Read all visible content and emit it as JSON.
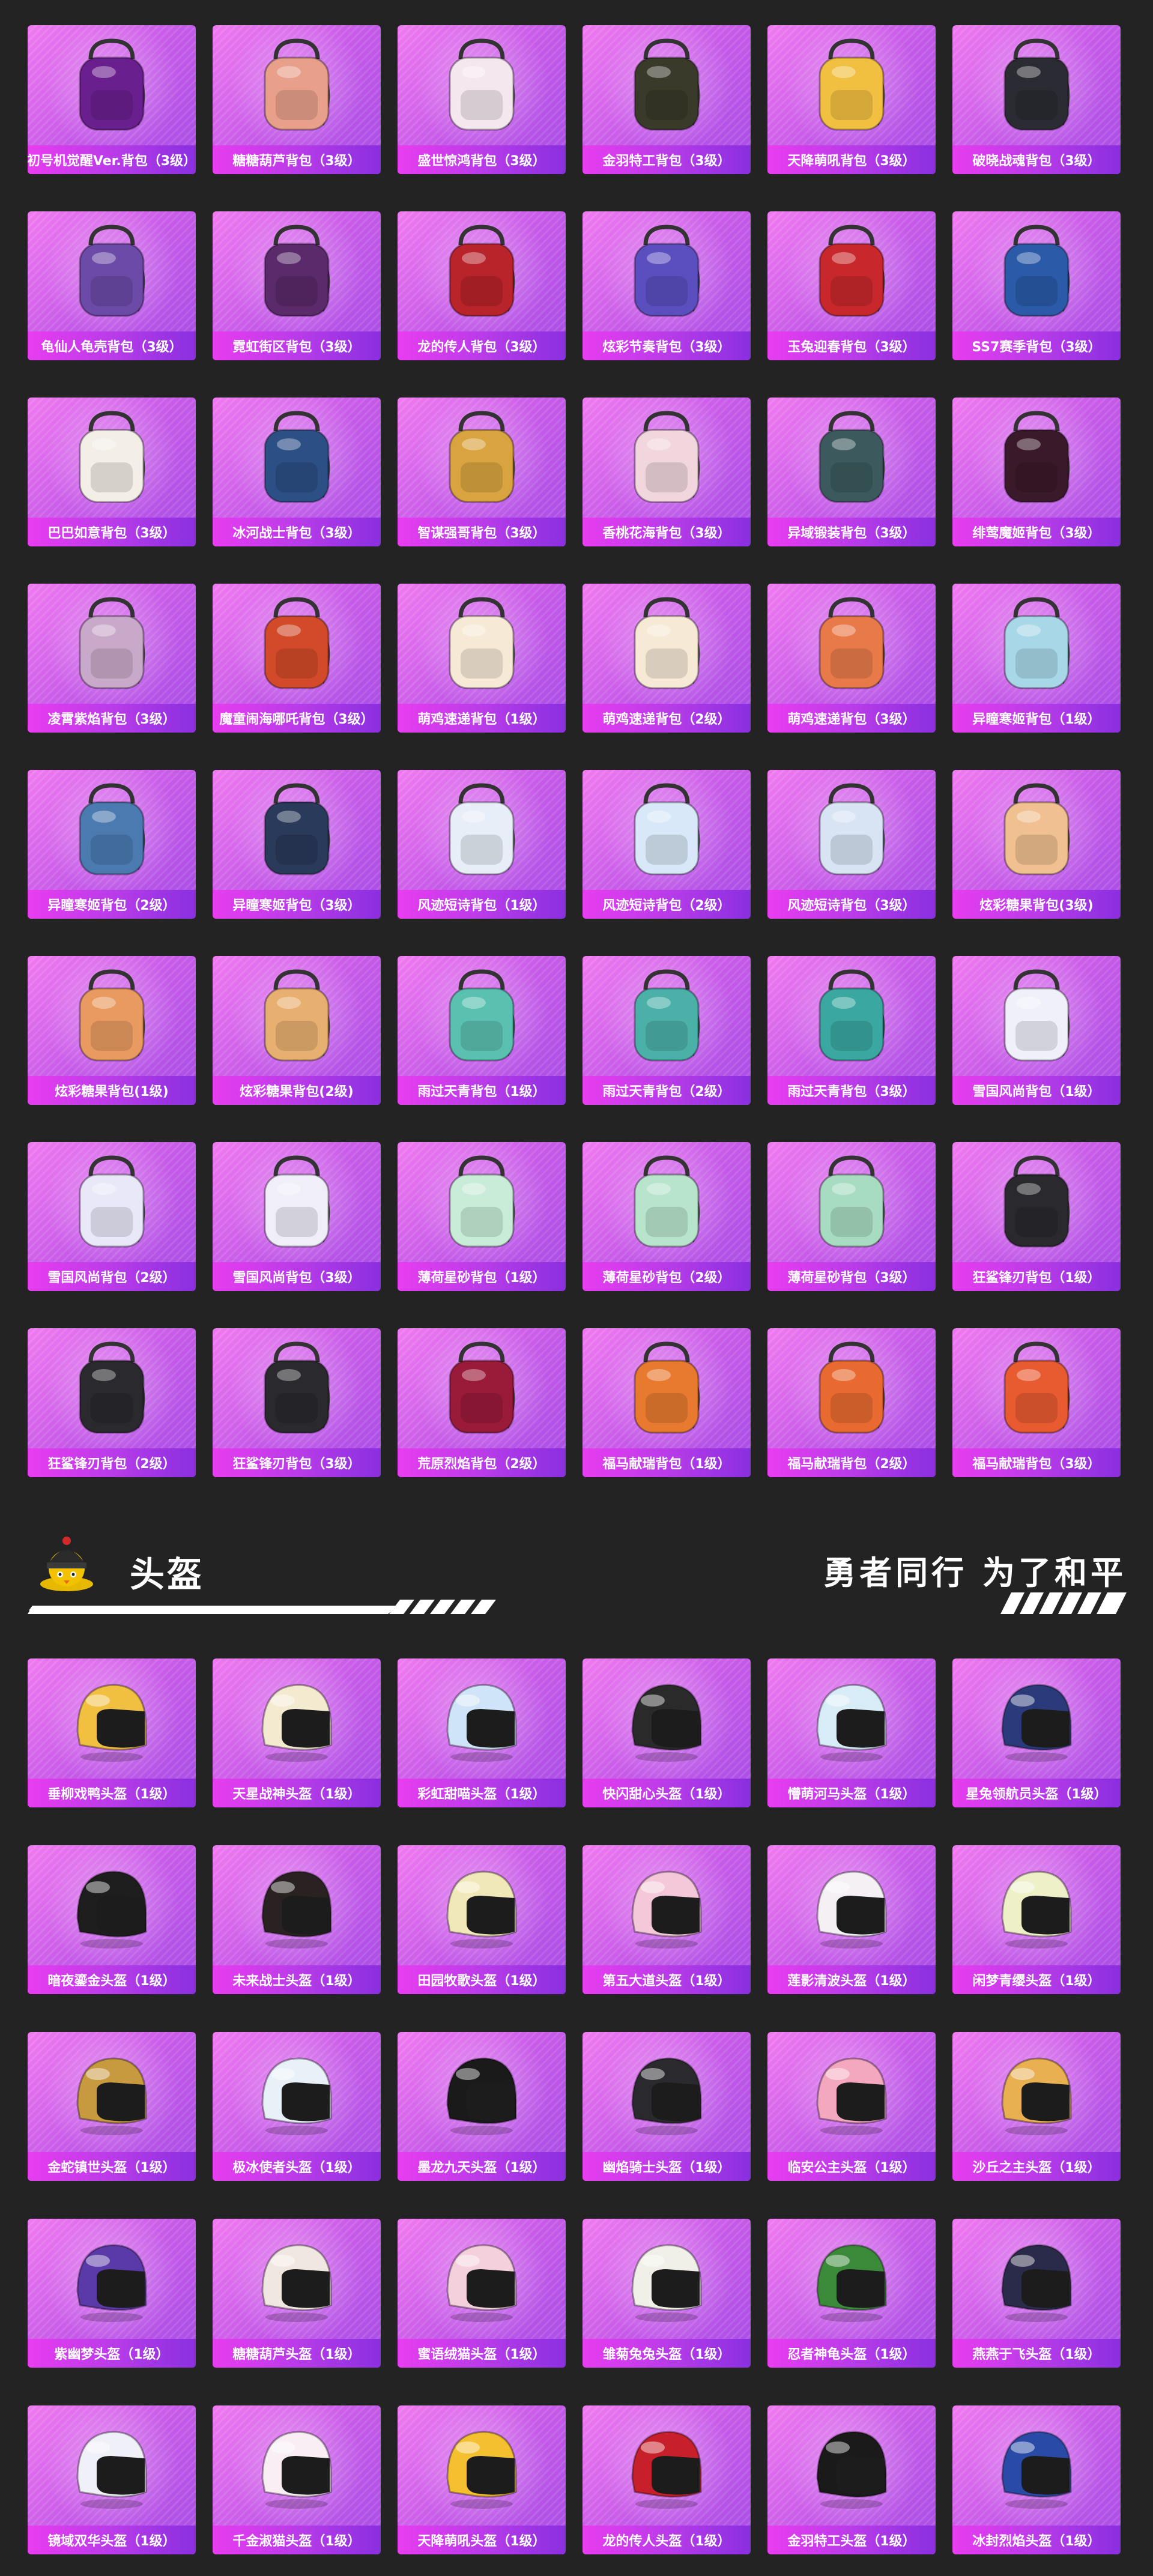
{
  "sections": {
    "helmets_title": "头盔",
    "slogan": "勇者同行 为了和平"
  },
  "backpacks": [
    {
      "name": "初号机觉醒Ver.背包（3级）",
      "color": "#6a1f8f",
      "shape": "backpack"
    },
    {
      "name": "糖糖葫芦背包（3级）",
      "color": "#e8a08a",
      "shape": "backpack"
    },
    {
      "name": "盛世惊鸿背包（3级）",
      "color": "#f4e8ee",
      "shape": "backpack"
    },
    {
      "name": "金羽特工背包（3级）",
      "color": "#3a3a2a",
      "shape": "backpack"
    },
    {
      "name": "天降萌吼背包（3级）",
      "color": "#f1c040",
      "shape": "backpack"
    },
    {
      "name": "破晓战魂背包（3级）",
      "color": "#2b2b33",
      "shape": "backpack"
    },
    {
      "name": "龟仙人龟壳背包（3级）",
      "color": "#6b4aa8",
      "shape": "backpack"
    },
    {
      "name": "霓虹街区背包（3级）",
      "color": "#5a2a6a",
      "shape": "backpack"
    },
    {
      "name": "龙的传人背包（3级）",
      "color": "#b8242a",
      "shape": "backpack"
    },
    {
      "name": "炫彩节奏背包（3级）",
      "color": "#5b4fc0",
      "shape": "backpack"
    },
    {
      "name": "玉兔迎春背包（3级）",
      "color": "#c8282c",
      "shape": "backpack"
    },
    {
      "name": "SS7赛季背包（3级）",
      "color": "#2a5aa8",
      "shape": "backpack"
    },
    {
      "name": "巴巴如意背包（3级）",
      "color": "#f3eee6",
      "shape": "backpack"
    },
    {
      "name": "冰河战士背包（3级）",
      "color": "#2c4f86",
      "shape": "backpack"
    },
    {
      "name": "智谋强哥背包（3级）",
      "color": "#d9a440",
      "shape": "backpack"
    },
    {
      "name": "香桃花海背包（3级）",
      "color": "#f2d6de",
      "shape": "backpack"
    },
    {
      "name": "异域锻装背包（3级）",
      "color": "#3c5a5e",
      "shape": "backpack"
    },
    {
      "name": "绯莺魔姬背包（3级）",
      "color": "#3a1a2a",
      "shape": "backpack"
    },
    {
      "name": "凌霄紫焰背包（3级）",
      "color": "#c9a9c9",
      "shape": "backpack"
    },
    {
      "name": "魔童闹海哪吒背包（3级）",
      "color": "#d24a2a",
      "shape": "backpack"
    },
    {
      "name": "萌鸡速递背包（1级）",
      "color": "#f6ead6",
      "shape": "backpack"
    },
    {
      "name": "萌鸡速递背包（2级）",
      "color": "#f6ead6",
      "shape": "backpack"
    },
    {
      "name": "萌鸡速递背包（3级）",
      "color": "#e87a4a",
      "shape": "backpack"
    },
    {
      "name": "异瞳寒姬背包（1级）",
      "color": "#a8d8e8",
      "shape": "backpack"
    },
    {
      "name": "异瞳寒姬背包（2级）",
      "color": "#4a7ab0",
      "shape": "backpack"
    },
    {
      "name": "异瞳寒姬背包（3级）",
      "color": "#2a3a5a",
      "shape": "backpack"
    },
    {
      "name": "风迹短诗背包（1级）",
      "color": "#e8eef8",
      "shape": "backpack"
    },
    {
      "name": "风迹短诗背包（2级）",
      "color": "#d8e8f8",
      "shape": "backpack"
    },
    {
      "name": "风迹短诗背包（3级）",
      "color": "#d8e4f4",
      "shape": "backpack"
    },
    {
      "name": "炫彩糖果背包(3级)",
      "color": "#f0c090",
      "shape": "backpack"
    },
    {
      "name": "炫彩糖果背包(1级)",
      "color": "#e89a60",
      "shape": "backpack"
    },
    {
      "name": "炫彩糖果背包(2级)",
      "color": "#e8b070",
      "shape": "backpack"
    },
    {
      "name": "雨过天青背包（1级）",
      "color": "#5ac0b0",
      "shape": "backpack"
    },
    {
      "name": "雨过天青背包（2级）",
      "color": "#4ab0a8",
      "shape": "backpack"
    },
    {
      "name": "雨过天青背包（3级）",
      "color": "#3aa8a0",
      "shape": "backpack"
    },
    {
      "name": "雪国风尚背包（1级）",
      "color": "#f0f0fa",
      "shape": "backpack"
    },
    {
      "name": "雪国风尚背包（2级）",
      "color": "#e8e8f8",
      "shape": "backpack"
    },
    {
      "name": "雪国风尚背包（3级）",
      "color": "#f0eef8",
      "shape": "backpack"
    },
    {
      "name": "薄荷星砂背包（1级）",
      "color": "#c8ecd8",
      "shape": "backpack"
    },
    {
      "name": "薄荷星砂背包（2级）",
      "color": "#b8e4cc",
      "shape": "backpack"
    },
    {
      "name": "薄荷星砂背包（3级）",
      "color": "#a8dcc0",
      "shape": "backpack"
    },
    {
      "name": "狂鲨锋刃背包（1级）",
      "color": "#2a2a2e",
      "shape": "backpack"
    },
    {
      "name": "狂鲨锋刃背包（2级）",
      "color": "#2a2a2e",
      "shape": "backpack"
    },
    {
      "name": "狂鲨锋刃背包（3级）",
      "color": "#2a2a2e",
      "shape": "backpack"
    },
    {
      "name": "荒原烈焰背包（2级）",
      "color": "#9a1a3a",
      "shape": "backpack"
    },
    {
      "name": "福马献瑞背包（1级）",
      "color": "#e87a30",
      "shape": "backpack"
    },
    {
      "name": "福马献瑞背包（2级）",
      "color": "#e86a30",
      "shape": "backpack"
    },
    {
      "name": "福马献瑞背包（3级）",
      "color": "#e85a30",
      "shape": "backpack"
    }
  ],
  "helmets": [
    {
      "name": "垂柳戏鸭头盔（1级）",
      "color": "#f2c040"
    },
    {
      "name": "天星战神头盔（1级）",
      "color": "#f4ead0"
    },
    {
      "name": "彩虹甜喵头盔（1级）",
      "color": "#cfe4f8"
    },
    {
      "name": "快闪甜心头盔（1级）",
      "color": "#2a2a2a"
    },
    {
      "name": "懵萌河马头盔（1级）",
      "color": "#d8ecf8"
    },
    {
      "name": "星兔领航员头盔（1级）",
      "color": "#2a3a7a"
    },
    {
      "name": "暗夜鎏金头盔（1级）",
      "color": "#1e1e1e"
    },
    {
      "name": "未来战士头盔（1级）",
      "color": "#2a2222"
    },
    {
      "name": "田园牧歌头盔（1级）",
      "color": "#f0e8b8"
    },
    {
      "name": "第五大道头盔（1级）",
      "color": "#f4c8d8"
    },
    {
      "name": "莲影清波头盔（1级）",
      "color": "#f4f0f4"
    },
    {
      "name": "闲梦青缨头盔（1级）",
      "color": "#eef0c8"
    },
    {
      "name": "金蛇镇世头盔（1级）",
      "color": "#c89a40"
    },
    {
      "name": "极冰使者头盔（1级）",
      "color": "#e8f0f8"
    },
    {
      "name": "墨龙九天头盔（1级）",
      "color": "#1a1a1a"
    },
    {
      "name": "幽焰骑士头盔（1级）",
      "color": "#2a2a2e"
    },
    {
      "name": "临安公主头盔（1级）",
      "color": "#f4a8c0"
    },
    {
      "name": "沙丘之主头盔（1级）",
      "color": "#e8b050"
    },
    {
      "name": "紫幽梦头盔（1级）",
      "color": "#5a3aa8"
    },
    {
      "name": "糖糖葫芦头盔（1级）",
      "color": "#f0e8e0"
    },
    {
      "name": "蜜语绒猫头盔（1级）",
      "color": "#f4d0dc"
    },
    {
      "name": "雏菊兔兔头盔（1级）",
      "color": "#f0f0e8"
    },
    {
      "name": "忍者神龟头盔（1级）",
      "color": "#3a8a3a"
    },
    {
      "name": "燕燕于飞头盔（1级）",
      "color": "#2a2a4a"
    },
    {
      "name": "镜域双华头盔（1级）",
      "color": "#f0f0f8"
    },
    {
      "name": "千金淑猫头盔（1级）",
      "color": "#f8eef4"
    },
    {
      "name": "天降萌吼头盔（1级）",
      "color": "#f4c030"
    },
    {
      "name": "龙的传人头盔（1级）",
      "color": "#c8202a"
    },
    {
      "name": "金羽特工头盔（1级）",
      "color": "#1a1a1a"
    },
    {
      "name": "冰封烈焰头盔（1级）",
      "color": "#2a4aa8"
    }
  ]
}
